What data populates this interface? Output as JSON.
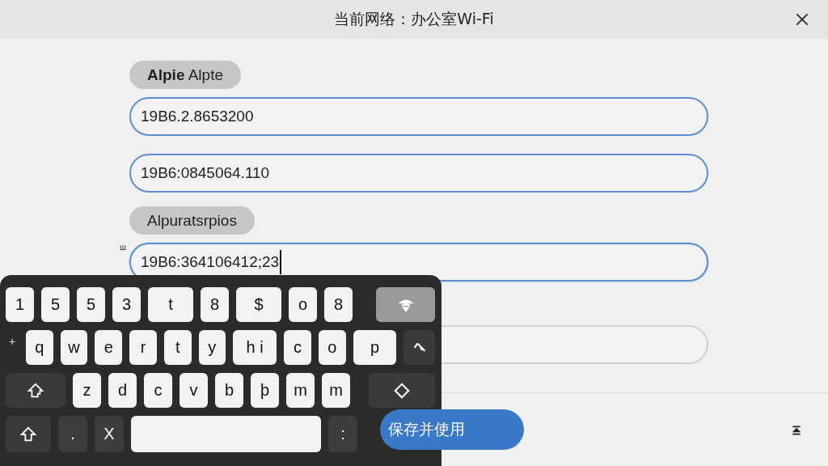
{
  "window": {
    "title": "当前网络：办公室Wi-Fi"
  },
  "form": [
    {
      "kind": "label",
      "text": "**Alpie** Alpte"
    },
    {
      "kind": "field",
      "value": "19B6.2.8653200",
      "highlighted": true,
      "focused": false
    },
    {
      "kind": "field",
      "value": "19B6:0845064.110",
      "highlighted": true,
      "focused": false
    },
    {
      "kind": "label",
      "text": "Alpuratsrpios"
    },
    {
      "kind": "field",
      "value": "19B6:364106412;23",
      "highlighted": true,
      "focused": true,
      "side_mark": "ш"
    },
    {
      "kind": "field",
      "highlighted": false,
      "focused": false
    }
  ],
  "keyboard": {
    "rows": [
      {
        "keys": [
          {
            "kind": "key",
            "label": "1"
          },
          {
            "kind": "key",
            "label": "5"
          },
          {
            "kind": "key",
            "label": "5"
          },
          {
            "kind": "key",
            "label": "3"
          },
          {
            "kind": "wide",
            "label": "t"
          },
          {
            "kind": "key",
            "label": "8"
          },
          {
            "kind": "wide",
            "label": "$"
          },
          {
            "kind": "key",
            "label": "o"
          },
          {
            "kind": "key",
            "label": "8"
          },
          {
            "kind": "wifi"
          }
        ]
      },
      {
        "lead": "+",
        "keys": [
          {
            "kind": "key",
            "label": "q"
          },
          {
            "kind": "key",
            "label": "w"
          },
          {
            "kind": "key",
            "label": "e"
          },
          {
            "kind": "key",
            "label": "r"
          },
          {
            "kind": "key",
            "label": "t"
          },
          {
            "kind": "key",
            "label": "y"
          },
          {
            "kind": "wide",
            "label": "h i"
          },
          {
            "kind": "key",
            "label": "c"
          },
          {
            "kind": "key",
            "label": "o"
          },
          {
            "kind": "wide",
            "label": "p"
          },
          {
            "kind": "backspace"
          }
        ]
      },
      {
        "keys": [
          {
            "kind": "caps"
          },
          {
            "kind": "key",
            "label": "z"
          },
          {
            "kind": "key",
            "label": "d"
          },
          {
            "kind": "key",
            "label": "c"
          },
          {
            "kind": "key",
            "label": "v"
          },
          {
            "kind": "key",
            "label": "b"
          },
          {
            "kind": "key",
            "label": "þ"
          },
          {
            "kind": "key",
            "label": "m"
          },
          {
            "kind": "key",
            "label": "m"
          },
          {
            "kind": "diamond"
          }
        ]
      },
      {
        "keys": [
          {
            "kind": "shift"
          },
          {
            "kind": "dark",
            "label": "."
          },
          {
            "kind": "dark",
            "label": "X"
          },
          {
            "kind": "space"
          },
          {
            "kind": "dark",
            "label": ":"
          }
        ]
      }
    ]
  },
  "save_button": "保存并使用"
}
